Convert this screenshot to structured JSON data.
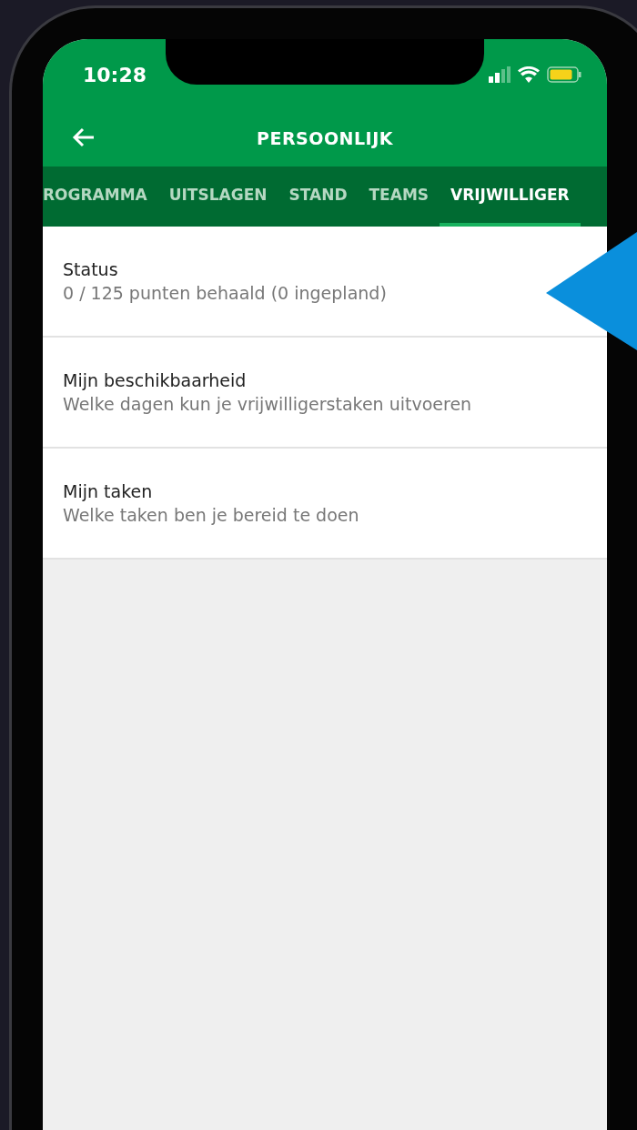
{
  "status_bar": {
    "time": "10:28"
  },
  "header": {
    "title": "PERSOONLIJK"
  },
  "tabs": [
    {
      "label": "ROGRAMMA",
      "selected": false
    },
    {
      "label": "UITSLAGEN",
      "selected": false
    },
    {
      "label": "STAND",
      "selected": false
    },
    {
      "label": "TEAMS",
      "selected": false
    },
    {
      "label": "VRIJWILLIGER",
      "selected": true
    }
  ],
  "items": [
    {
      "title": "Status",
      "subtitle": "0 / 125 punten behaald (0 ingepland)"
    },
    {
      "title": "Mijn beschikbaarheid",
      "subtitle": "Welke dagen kun je vrijwilligerstaken uitvoeren"
    },
    {
      "title": "Mijn taken",
      "subtitle": "Welke taken ben je bereid te doen"
    }
  ]
}
